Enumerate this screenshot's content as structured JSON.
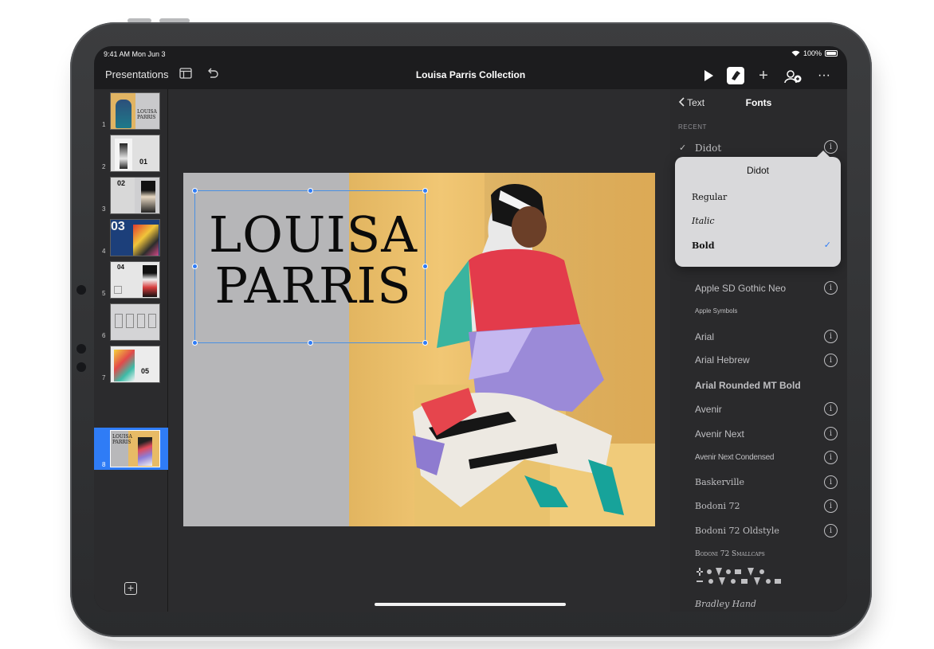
{
  "status": {
    "time": "9:41 AM  Mon Jun 3",
    "battery": "100%"
  },
  "toolbar": {
    "back_label": "Presentations",
    "doc_title": "Louisa Parris Collection"
  },
  "sidebar": {
    "slides": [
      "1",
      "2",
      "3",
      "4",
      "5",
      "6",
      "7",
      "8"
    ],
    "selected": "8"
  },
  "thumbs": {
    "t1": "LOUISA PARRIS",
    "t2": "01",
    "t3": "02",
    "t4": "03",
    "t5": "04",
    "t7": "05",
    "t8": "LOUISA PARRIS"
  },
  "slide": {
    "title_line1": "LOUISA",
    "title_line2": "PARRIS"
  },
  "panel": {
    "back_label": "Text",
    "title": "Fonts",
    "recent_label": "RECENT",
    "recent_font": "Didot",
    "fonts": [
      "Apple SD Gothic Neo",
      "Apple Symbols",
      "Arial",
      "Arial Hebrew",
      "Arial Rounded MT Bold",
      "Avenir",
      "Avenir Next",
      "Avenir Next Condensed",
      "Baskerville",
      "Bodoni 72",
      "Bodoni 72 Oldstyle",
      "Bodoni 72 Smallcaps",
      "Bradley Hand"
    ]
  },
  "popover": {
    "title": "Didot",
    "styles": [
      "Regular",
      "Italic",
      "Bold"
    ],
    "selected": "Bold"
  },
  "colors": {
    "accent": "#2f7cf6",
    "panel_bg": "#2a2a2c",
    "photo_bg": "#eec16e"
  }
}
